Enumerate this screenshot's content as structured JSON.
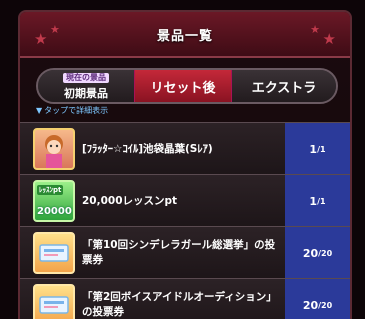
{
  "header": {
    "title": "景品一覧"
  },
  "tabs": {
    "current_badge": "現在の景品",
    "current_label": "初期景品",
    "reset_label": "リセット後",
    "extra_label": "エクストラ"
  },
  "hint": "タップで詳細表示",
  "items": [
    {
      "name": "[ﾌﾗｯﾀｰ☆ｺｲﾙ]池袋晶葉(Sﾚｱ)",
      "qty": "1",
      "qty_total": "/1",
      "icon": "idol-card-icon"
    },
    {
      "name": "20,000レッスンpt",
      "qty": "1",
      "qty_total": "/1",
      "icon": "lesson-pt-icon",
      "icon_top": "ﾚｯｽﾝpt",
      "icon_bottom": "20000"
    },
    {
      "name": "「第10回シンデレラガール総選挙」の投票券",
      "qty": "20",
      "qty_total": "/20",
      "icon": "ticket-icon"
    },
    {
      "name": "「第2回ボイスアイドルオーディション」の投票券",
      "qty": "20",
      "qty_total": "/20",
      "icon": "ticket-icon"
    }
  ],
  "colors": {
    "accent_red": "#c42839",
    "qty_blue": "#2b3a9a",
    "hint_blue": "#7ec8ff"
  }
}
